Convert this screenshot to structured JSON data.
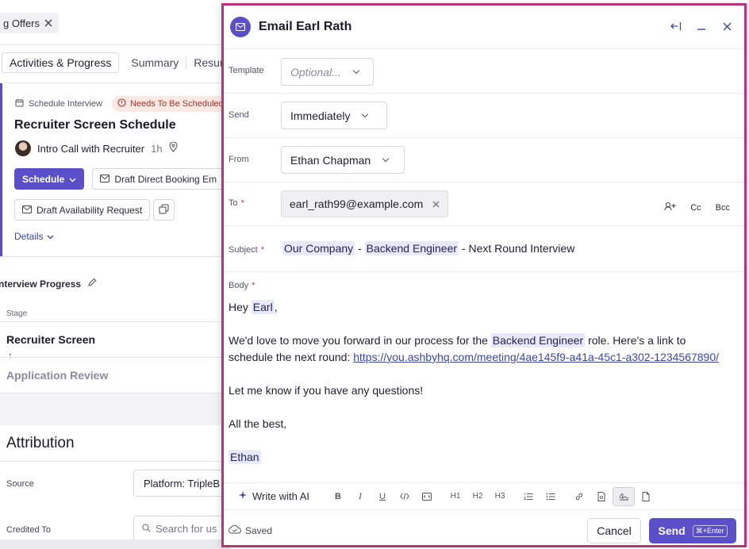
{
  "background": {
    "filter_chip": "g Offers",
    "tabs": [
      "Activities & Progress",
      "Summary",
      "Resum"
    ],
    "activity": {
      "type_label": "Schedule Interview",
      "warning_badge": "Needs To Be Scheduled",
      "title": "Recruiter Screen Schedule",
      "interview_name": "Intro Call with Recruiter",
      "duration": "1h",
      "schedule_button": "Schedule",
      "draft_direct_booking": "Draft Direct Booking Em",
      "draft_availability": "Draft Availability Request",
      "details_link": "Details"
    },
    "interview_progress": {
      "title": "nterview Progress",
      "stage_header": "Stage",
      "stages": [
        "Recruiter Screen",
        "Application Review"
      ],
      "arrow": "↑"
    },
    "attribution": {
      "title": "Attribution",
      "source_label": "Source",
      "source_value": "Platform: TripleB",
      "credited_label": "Credited To",
      "credited_placeholder": "Search for us"
    }
  },
  "modal": {
    "title": "Email Earl Rath",
    "template": {
      "label": "Template",
      "placeholder": "Optional..."
    },
    "send": {
      "label": "Send",
      "value": "Immediately"
    },
    "from": {
      "label": "From",
      "value": "Ethan Chapman"
    },
    "to": {
      "label": "To",
      "required": "*",
      "email": "earl_rath99@example.com",
      "cc": "Cc",
      "bcc": "Bcc"
    },
    "subject": {
      "label": "Subject",
      "required": "*",
      "company": "Our Company",
      "sep1": " - ",
      "role": "Backend Engineer",
      "rest": " - Next Round Interview"
    },
    "body": {
      "label": "Body",
      "required": "*",
      "greeting_prefix": "Hey ",
      "greeting_name": "Earl",
      "greeting_suffix": ",",
      "p1_prefix": "We'd love to move you forward in our process for the ",
      "p1_role": "Backend Engineer",
      "p1_suffix": " role. Here's a link to schedule the next round: ",
      "p1_link": "https://you.ashbyhq.com/meeting/4ae145f9-a41a-45c1-a302-1234567890/",
      "p2": "Let me know if you have any questions!",
      "p3": "All the best,",
      "signature": "Ethan"
    },
    "toolbar": {
      "write_ai": "Write with AI",
      "h1": "H1",
      "h2": "H2",
      "h3": "H3"
    },
    "footer": {
      "saved": "Saved",
      "cancel": "Cancel",
      "send": "Send",
      "shortcut": "⌘+Enter"
    }
  },
  "colors": {
    "accent": "#5b4fc9",
    "modal_border": "#b8337a",
    "link": "#3b46a8",
    "token_bg": "#e8e9fb"
  }
}
